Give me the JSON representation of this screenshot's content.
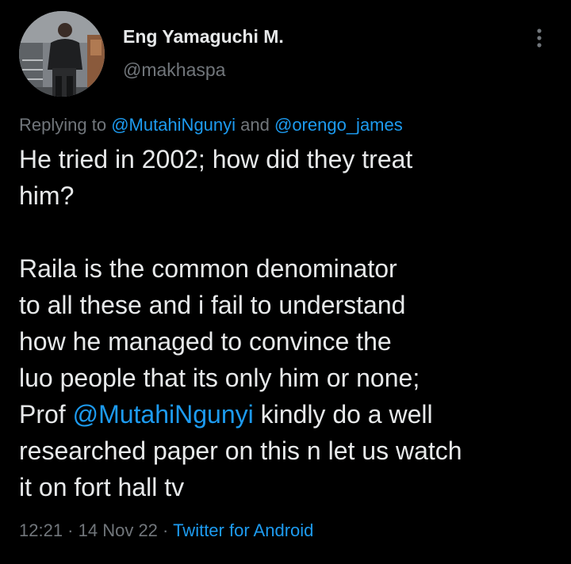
{
  "author": {
    "display_name": "Eng Yamaguchi M.",
    "handle": "@makhaspa"
  },
  "reply_context": {
    "prefix": "Replying to ",
    "mention_1": "@MutahiNgunyi",
    "joiner": " and ",
    "mention_2": "@orengo_james"
  },
  "tweet": {
    "line_1": "He tried in 2002; how did they treat",
    "line_2": "him?",
    "line_3": "Raila is the common denominator",
    "line_4": "to all these and i fail to understand",
    "line_5": "how he managed to convince the",
    "line_6": "luo people that its only him or none;",
    "line_7_prefix": "Prof ",
    "line_7_mention": "@MutahiNgunyi",
    "line_7_suffix": " kindly do a well",
    "line_8": "researched paper on this n let us watch",
    "line_9": "it on fort hall tv"
  },
  "meta": {
    "time": "12:21",
    "sep_1": " · ",
    "date": "14 Nov 22",
    "sep_2": " · ",
    "source": "Twitter for Android"
  },
  "icons": {
    "more": "more-vertical-icon"
  },
  "colors": {
    "background": "#000000",
    "primary_text": "#e7e9ea",
    "secondary_text": "#71767b",
    "link": "#1d9bf0"
  }
}
